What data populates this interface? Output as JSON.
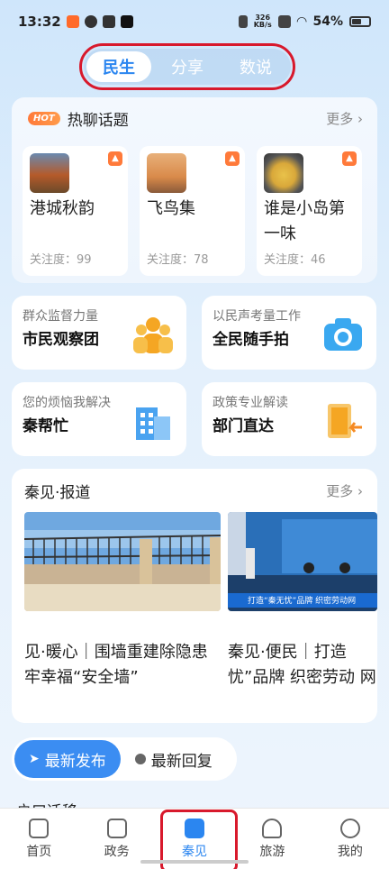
{
  "status": {
    "time": "13:32",
    "net_speed_value": "326",
    "net_speed_unit": "KB/s",
    "battery": "54%"
  },
  "top_tabs": [
    "民生",
    "分享",
    "数说"
  ],
  "hot": {
    "badge": "HOT",
    "title": "热聊话题",
    "more": "更多",
    "topics": [
      {
        "name": "港城秋韵",
        "attention": "关注度：99"
      },
      {
        "name": "飞鸟集",
        "attention": "关注度：78"
      },
      {
        "name": "谁是小岛第一味",
        "attention": "关注度：46"
      }
    ]
  },
  "features": [
    {
      "sub": "群众监督力量",
      "title": "市民观察团",
      "icon": "people-icon"
    },
    {
      "sub": "以民声考量工作",
      "title": "全民随手拍",
      "icon": "camera-icon"
    },
    {
      "sub": "您的烦恼我解决",
      "title": "秦帮忙",
      "icon": "building-icon"
    },
    {
      "sub": "政策专业解读",
      "title": "部门直达",
      "icon": "door-icon"
    }
  ],
  "news": {
    "title": "秦见·报道",
    "more": "更多",
    "items": [
      {
        "text": "见·暖心｜围墙重建除隐患 牢幸福“安全墙”"
      },
      {
        "text": "秦见·便民｜打造 忧”品牌 织密劳动 网",
        "img_caption": "打造“秦无忧”品牌 织密劳动网"
      }
    ]
  },
  "feed_tabs": [
    "最新发布",
    "最新回复"
  ],
  "partial_item": "户口迁移",
  "nav": [
    "首页",
    "政务",
    "秦见",
    "旅游",
    "我的"
  ],
  "colors": {
    "accent": "#2b86f0",
    "highlight": "#d8192c"
  }
}
